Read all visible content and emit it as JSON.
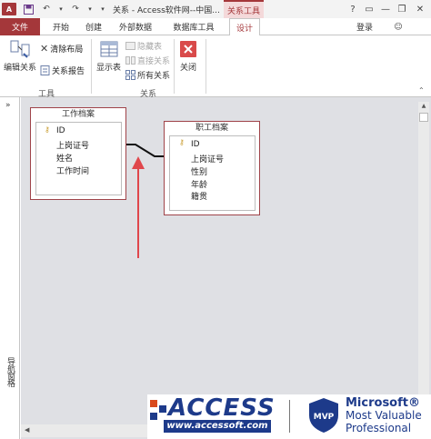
{
  "window": {
    "title": "关系 - Access软件网--中国...",
    "contextual_tab_group": "关系工具",
    "app_logo": "A"
  },
  "tabs": {
    "file": "文件",
    "home": "开始",
    "create": "创建",
    "external": "外部数据",
    "db_tools": "数据库工具",
    "design": "设计",
    "login": "登录"
  },
  "ribbon": {
    "tools": {
      "label": "工具",
      "edit_relationships": "编辑关系",
      "clear_layout": "清除布局",
      "relationship_report": "关系报告"
    },
    "relationships": {
      "label": "关系",
      "show_table": "显示表",
      "hide_table": "隐藏表",
      "direct_relationships": "直接关系",
      "all_relationships": "所有关系"
    },
    "close": "关闭"
  },
  "nav_pane": {
    "label": "导航窗格",
    "chevron": "»"
  },
  "tables": [
    {
      "name": "工作档案",
      "fields": [
        "ID",
        "上岗证号",
        "姓名",
        "工作时间"
      ],
      "primary_key": "ID"
    },
    {
      "name": "职工档案",
      "fields": [
        "ID",
        "上岗证号",
        "性别",
        "年龄",
        "籍贯"
      ],
      "primary_key": "ID"
    }
  ],
  "banner": {
    "access": "ACCESS",
    "url": "www.accessoft.com",
    "mvp": "MVP",
    "ms_line1": "Microsoft®",
    "ms_line2": "Most Valuable",
    "ms_line3": "Professional"
  },
  "colors": {
    "accent": "#a4373a",
    "arrow": "#e0474c",
    "brand_blue": "#1d3a8a"
  }
}
